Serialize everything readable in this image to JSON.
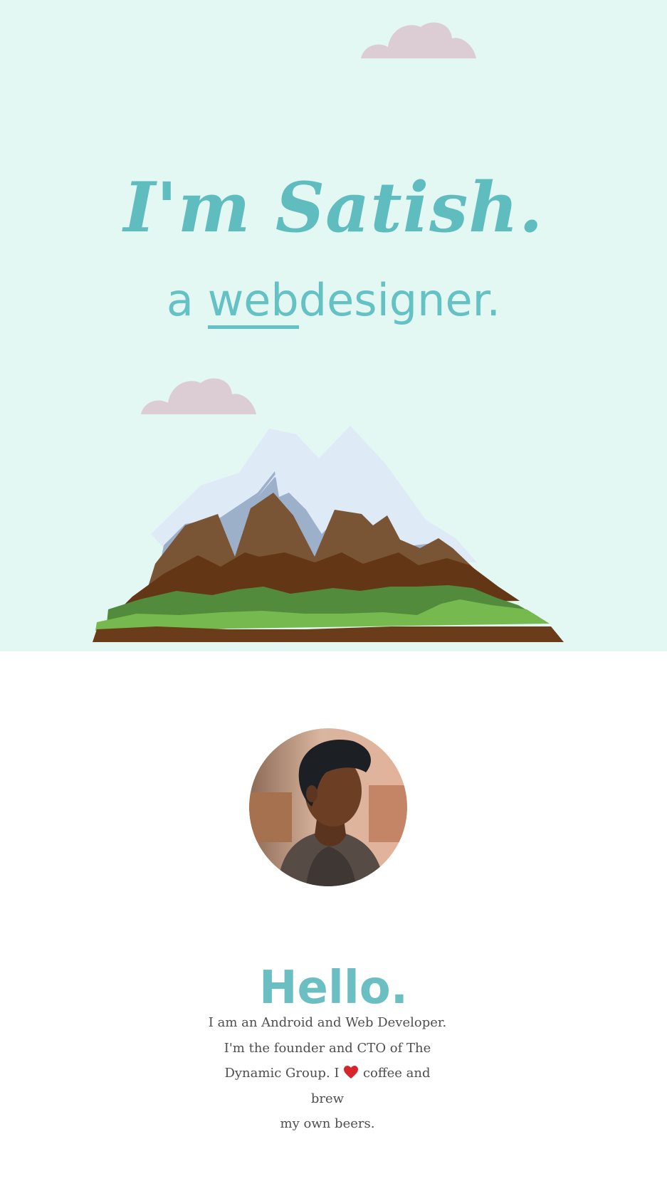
{
  "hero": {
    "title": "I'm Satish.",
    "subtitle_prefix": "a ",
    "subtitle_highlight": "web ",
    "subtitle_suffix": "designer."
  },
  "about": {
    "heading": "Hello.",
    "bio_line_1": "I am an Android and Web Developer.",
    "bio_line_2": "I'm the founder and CTO of The",
    "bio_line_3_start": "Dynamic Group. I ",
    "bio_line_3_end": " coffee and brew",
    "bio_line_4": "my own beers.",
    "heart_icon": "heart-icon"
  },
  "colors": {
    "hero_background": "#e3f7f3",
    "accent": "#5fbcbf",
    "text": "#4e4e4e",
    "cloud": "#dbcdd3",
    "heart": "#d7262b"
  }
}
